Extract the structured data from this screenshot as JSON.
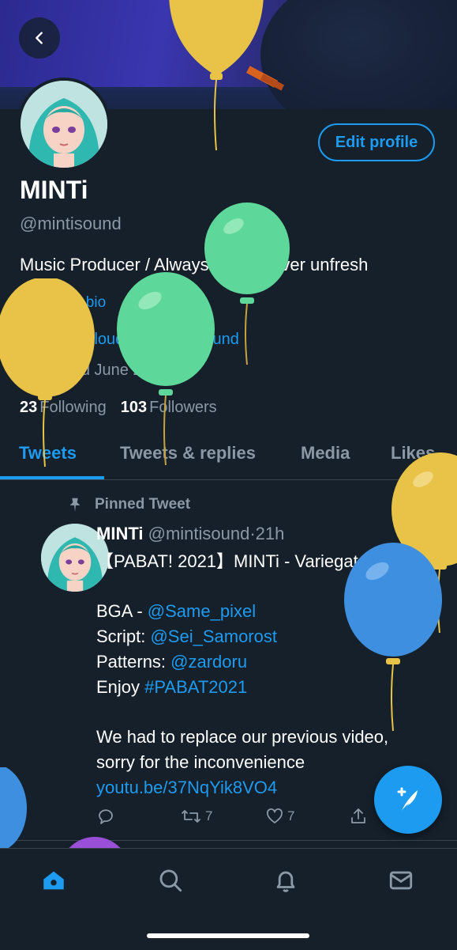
{
  "profile": {
    "name": "MINTi",
    "handle": "@mintisound",
    "bio": "Music Producer / Always fresh, never unfresh",
    "translate_label": "Translate bio",
    "link": "soundcloud.com/mintisound",
    "joined": "Joined June 2013",
    "following_count": "23",
    "following_label": "Following",
    "followers_count": "103",
    "followers_label": "Followers",
    "edit_label": "Edit profile"
  },
  "tabs": [
    {
      "label": "Tweets",
      "active": true
    },
    {
      "label": "Tweets & replies",
      "active": false
    },
    {
      "label": "Media",
      "active": false
    },
    {
      "label": "Likes",
      "active": false
    }
  ],
  "tweet": {
    "pinned_label": "Pinned Tweet",
    "author_name": "MINTi",
    "author_handle": "@mintisound",
    "separator": "·",
    "time": "21h",
    "line1": "【PABAT! 2021】MINTi - Variegata",
    "bga_prefix": "BGA - ",
    "bga_mention": "@Same_pixel",
    "script_prefix": "Script: ",
    "script_mention": "@Sei_Samorost",
    "patterns_prefix": "Patterns: ",
    "patterns_mention": "@zardoru",
    "enjoy_prefix": "Enjoy ",
    "hashtag": "#PABAT2021",
    "line_replace1": "We had to replace our previous video,",
    "line_replace2": "sorry for the inconvenience",
    "url": "youtu.be/37NqYik8VO4",
    "retweets": "7",
    "likes": "7",
    "more": "···"
  },
  "colors": {
    "background": "#15202b",
    "accent": "#1d9bf0",
    "secondary_text": "#8b98a5",
    "balloon_yellow": "#e8c348",
    "balloon_green": "#5ed79a",
    "balloon_blue": "#3f8fe0",
    "balloon_purple": "#9a4fd8"
  },
  "icons": {
    "back": "chevron-left-icon",
    "pin": "pin-icon",
    "link": "link-icon",
    "calendar": "calendar-icon",
    "reply": "reply-icon",
    "retweet": "retweet-icon",
    "like": "heart-icon",
    "share": "share-icon",
    "compose": "compose-icon",
    "home": "home-icon",
    "search": "search-icon",
    "notifications": "bell-icon",
    "messages": "mail-icon"
  }
}
